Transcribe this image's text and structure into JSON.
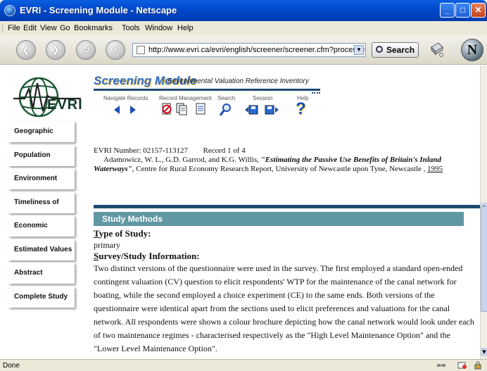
{
  "window": {
    "title": "EVRI - Screening Module - Netscape",
    "minimize": "_",
    "maximize": "□",
    "close": "✕"
  },
  "menu": [
    "File",
    "Edit",
    "View",
    "Go",
    "Bookmarks",
    "Tools",
    "Window",
    "Help"
  ],
  "navbar": {
    "url": "http://www.evri.ca/evri/english/screener/screener.cfm?process=next&",
    "search_label": "Search",
    "netscape_logo": "N"
  },
  "header": {
    "logo_text": "EVRI",
    "module_title": "Screening Module",
    "module_subtitle": "Environmental Valuation Reference Inventory"
  },
  "toolbar": {
    "navigate_label": "Navigate Records",
    "record_label": "Record Management",
    "search_label": "Search",
    "session_label": "Session",
    "help_label": "Help",
    "help_glyph": "?"
  },
  "sidebar": {
    "items": [
      {
        "label": "Geographic"
      },
      {
        "label": "Population"
      },
      {
        "label": "Environment"
      },
      {
        "label": "Timeliness of Data"
      },
      {
        "label": "Economic Measure"
      },
      {
        "label": "Estimated Values"
      },
      {
        "label": "Abstract"
      },
      {
        "label": "Complete Study"
      }
    ]
  },
  "record": {
    "number_text": "EVRI Number: 02157-113127",
    "position_text": "Record 1 of 4",
    "authors": "Adamowicz, W. L., G.D. Garrod, and K.G. Willis,",
    "title": "\"Estimating the Passive Use Benefits of Britain's Inland Waterways\"",
    "publisher": ", Centre for Rural Economy Research Report, University of Newcastle upon Tyne, Newcastle ,",
    "year": "1995"
  },
  "study": {
    "section_title": "Study Methods",
    "type_first_letter": "T",
    "type_rest": "ype of Study:",
    "type_value": "primary",
    "survey_first_letter": "S",
    "survey_rest": "urvey/Study Information:",
    "survey_text": "Two distinct versions of the questionnaire were used in the survey. The first employed a standard open-ended contingent valuation (CV) question to elicit respondents' WTP for the maintenance of the canal network for boating, while the second employed a choice experiment (CE) to the same ends. Both versions of the questionnaire were identical apart from the sections used to elicit preferences and valuations for the canal network. All respondents were shown a colour brochure depicting how the canal network would look under each of two maintenance regimes - characterised respectively as the \"High Level Maintenance Option\" and the \"Lower Level Maintenance Option\"."
  },
  "statusbar": {
    "status": "Done"
  },
  "colors": {
    "titlebar": "#0047c9",
    "section_bar": "#5f97a3",
    "rule": "#1e4a73",
    "module_title": "#2e6fd0"
  }
}
